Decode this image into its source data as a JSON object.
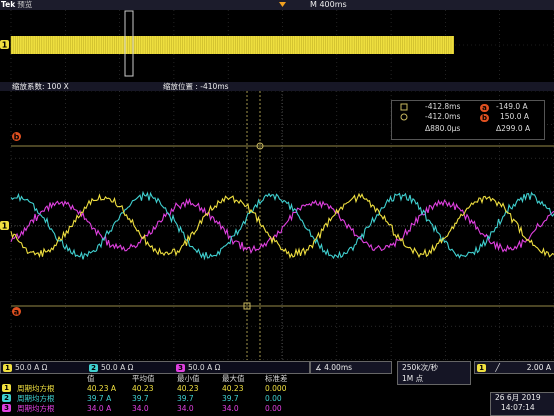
{
  "header": {
    "brand": "Tek",
    "mode": "预览",
    "timebase": "M 400ms"
  },
  "zoom_bar": {
    "factor_label": "缩放系数: 100 X",
    "position_label": "缩放位置 : -410ms"
  },
  "cursor_readout": {
    "a_time": "-412.8ms",
    "a_value": "-149.0 A",
    "b_time": "-412.0ms",
    "b_value": "150.0 A",
    "delta_time": "Δ880.0μs",
    "delta_value": "Δ299.0 A",
    "marker_a": "a",
    "marker_b": "b"
  },
  "markers": {
    "ch1": "1",
    "ref_a": "b",
    "ref_b": "a"
  },
  "channels": [
    {
      "num": "1",
      "scale": "50.0 A Ω",
      "color": "#f0e040"
    },
    {
      "num": "2",
      "scale": "50.0 A Ω",
      "color": "#40d0d0"
    },
    {
      "num": "3",
      "scale": "50.0 A Ω",
      "color": "#e040e0"
    }
  ],
  "horizontal": {
    "scale": "4.00ms",
    "sample_rate": "250k次/秒",
    "record": "1M 点"
  },
  "trigger": {
    "channel": "1",
    "slope_icon": "rising-edge-icon",
    "level": "2.00 A"
  },
  "measurements": {
    "headers": [
      "值",
      "平均值",
      "最小值",
      "最大值",
      "标准差"
    ],
    "rows": [
      {
        "ch": "1",
        "name": "周期均方根",
        "value": "40.23 A",
        "mean": "40.23",
        "min": "40.23",
        "max": "40.23",
        "std": "0.000",
        "color": "#f0e040"
      },
      {
        "ch": "2",
        "name": "周期均方根",
        "value": "39.7 A",
        "mean": "39.7",
        "min": "39.7",
        "max": "39.7",
        "std": "0.00",
        "color": "#40d0d0"
      },
      {
        "ch": "3",
        "name": "周期均方根",
        "value": "34.0 A",
        "mean": "34.0",
        "min": "34.0",
        "max": "34.0",
        "std": "0.00",
        "color": "#e040e0"
      }
    ]
  },
  "clock": {
    "date": "26 6月 2019",
    "time": "14:07:14"
  },
  "colors": {
    "ch1": "#f0e040",
    "ch2": "#40d0d0",
    "ch3": "#e040e0",
    "ref": "#e05020",
    "cursor": "#c8b860"
  }
}
